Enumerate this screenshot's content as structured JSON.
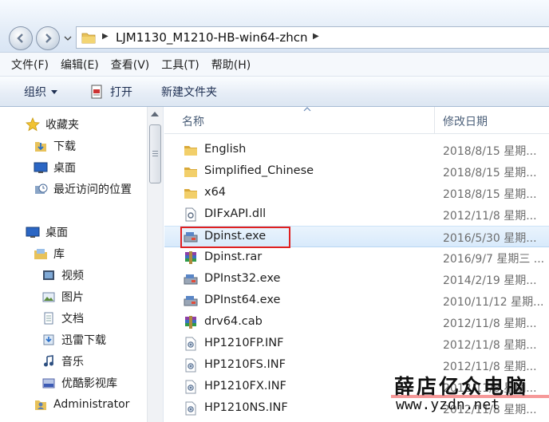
{
  "address": {
    "path": "LJM1130_M1210-HB-win64-zhcn"
  },
  "menu": [
    "文件(F)",
    "编辑(E)",
    "查看(V)",
    "工具(T)",
    "帮助(H)"
  ],
  "toolbar": {
    "organize": "组织",
    "open": "打开",
    "new_folder": "新建文件夹"
  },
  "nav": {
    "favorites": "收藏夹",
    "downloads": "下载",
    "desktop": "桌面",
    "recent": "最近访问的位置",
    "desktop2": "桌面",
    "libraries": "库",
    "videos": "视频",
    "pictures": "图片",
    "documents": "文档",
    "xunlei": "迅雷下载",
    "music": "音乐",
    "youku": "优酷影视库",
    "admin": "Administrator"
  },
  "columns": {
    "name": "名称",
    "date": "修改日期"
  },
  "files": [
    {
      "name": "English",
      "date": "2018/8/15 星期...",
      "icon": "folder-icon"
    },
    {
      "name": "Simplified_Chinese",
      "date": "2018/8/15 星期...",
      "icon": "folder-icon"
    },
    {
      "name": "x64",
      "date": "2018/8/15 星期...",
      "icon": "folder-icon"
    },
    {
      "name": "DIFxAPI.dll",
      "date": "2012/11/8 星期...",
      "icon": "dll-icon"
    },
    {
      "name": "Dpinst.exe",
      "date": "2016/5/30 星期...",
      "icon": "installer-icon"
    },
    {
      "name": "Dpinst.rar",
      "date": "2016/9/7 星期三 ...",
      "icon": "archive-icon"
    },
    {
      "name": "DPInst32.exe",
      "date": "2014/2/19 星期...",
      "icon": "installer-icon"
    },
    {
      "name": "DPInst64.exe",
      "date": "2010/11/12 星期...",
      "icon": "installer-icon"
    },
    {
      "name": "drv64.cab",
      "date": "2012/11/8 星期...",
      "icon": "archive-icon"
    },
    {
      "name": "HP1210FP.INF",
      "date": "2012/11/8 星期...",
      "icon": "inf-icon"
    },
    {
      "name": "HP1210FS.INF",
      "date": "2012/11/8 星期...",
      "icon": "inf-icon"
    },
    {
      "name": "HP1210FX.INF",
      "date": "2012/11/8 星期...",
      "icon": "inf-icon"
    },
    {
      "name": "HP1210NS.INF",
      "date": "2012/11/8 星期...",
      "icon": "inf-icon"
    }
  ],
  "watermark": {
    "title": "薛店亿众电脑",
    "url": "www.yzdn.net"
  }
}
